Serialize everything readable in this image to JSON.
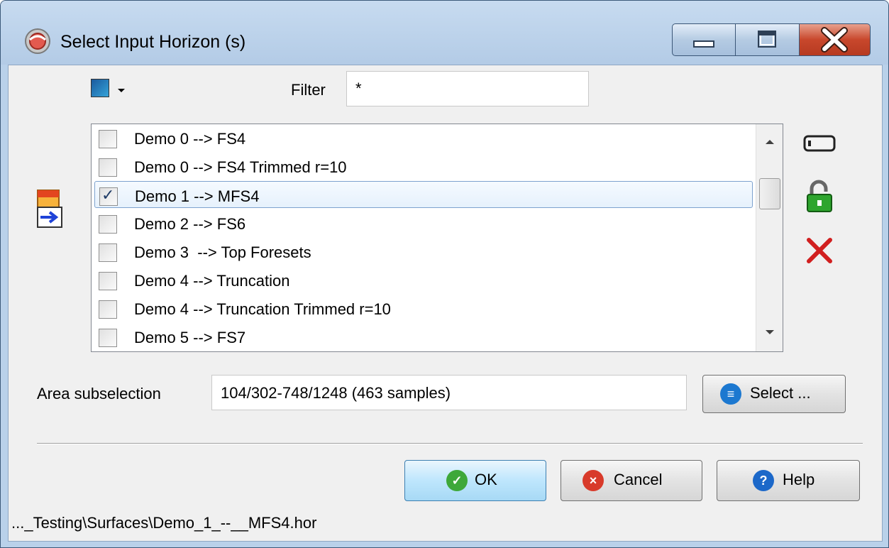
{
  "window": {
    "title": "Select Input Horizon (s)"
  },
  "toolbar": {
    "filter_label": "Filter",
    "filter_value": "*"
  },
  "horizon_list": {
    "items": [
      {
        "label": "Demo 0 --> FS4",
        "checked": false
      },
      {
        "label": "Demo 0 --> FS4 Trimmed r=10",
        "checked": false
      },
      {
        "label": "Demo 1 --> MFS4",
        "checked": true
      },
      {
        "label": "Demo 2 --> FS6",
        "checked": false
      },
      {
        "label": "Demo 3  --> Top Foresets",
        "checked": false
      },
      {
        "label": "Demo 4 --> Truncation",
        "checked": false
      },
      {
        "label": "Demo 4 --> Truncation Trimmed r=10",
        "checked": false
      },
      {
        "label": "Demo 5 --> FS7",
        "checked": false
      }
    ],
    "check_mark": "✓"
  },
  "area": {
    "label": "Area subselection",
    "value": "104/302-748/1248 (463 samples)",
    "select_label": "Select ..."
  },
  "buttons": {
    "ok": "OK",
    "cancel": "Cancel",
    "help": "Help"
  },
  "status": {
    "path": "..._Testing\\Surfaces\\Demo_1_--__MFS4.hor"
  },
  "icons": {
    "ok_glyph": "✓",
    "cancel_glyph": "×",
    "help_glyph": "?",
    "select_glyph": "≡"
  },
  "colors": {
    "ok_icon": "#3ea83a",
    "cancel_icon": "#d83a2a",
    "help_icon": "#1c68c9",
    "select_icon": "#1c78d0"
  }
}
